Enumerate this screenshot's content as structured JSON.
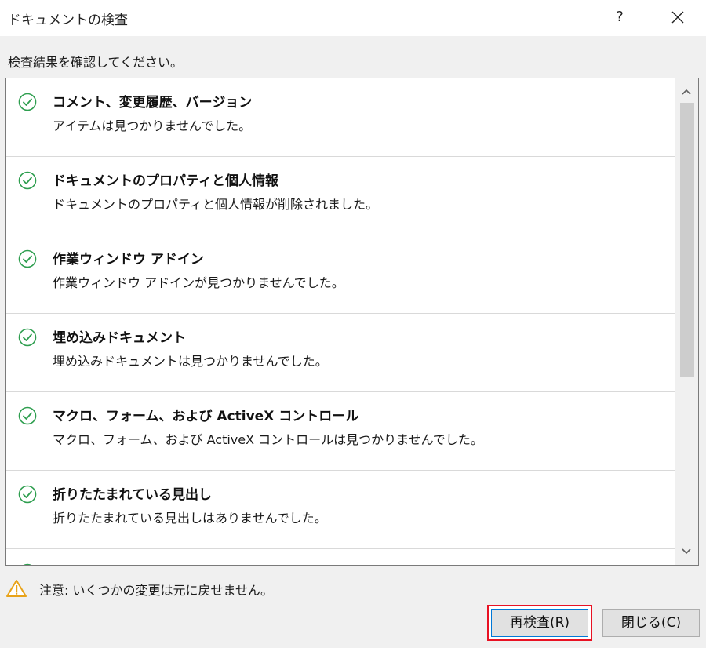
{
  "window": {
    "title": "ドキュメントの検査",
    "help_label": "?",
    "close_label": "✕"
  },
  "instruction": "検査結果を確認してください。",
  "results": [
    {
      "title": "コメント、変更履歴、バージョン",
      "desc": "アイテムは見つかりませんでした。"
    },
    {
      "title": "ドキュメントのプロパティと個人情報",
      "desc": "ドキュメントのプロパティと個人情報が削除されました。"
    },
    {
      "title": "作業ウィンドウ アドイン",
      "desc": "作業ウィンドウ アドインが見つかりませんでした。"
    },
    {
      "title": "埋め込みドキュメント",
      "desc": "埋め込みドキュメントは見つかりませんでした。"
    },
    {
      "title": "マクロ、フォーム、および ActiveX コントロール",
      "desc": "マクロ、フォーム、および ActiveX コントロールは見つかりませんでした。"
    },
    {
      "title": "折りたたまれている見出し",
      "desc": "折りたたまれている見出しはありませんでした。"
    }
  ],
  "scrollbar": {
    "up": "˄",
    "down": "˅"
  },
  "warning": "注意: いくつかの変更は元に戻せません。",
  "buttons": {
    "reinspect": "再検査(R)",
    "reinspect_prefix": "再検査(",
    "reinspect_key": "R",
    "reinspect_suffix": ")",
    "close": "閉じる(C)",
    "close_prefix": "閉じる(",
    "close_key": "C",
    "close_suffix": ")"
  },
  "colors": {
    "check": "#2e9e4f",
    "warning": "#e8a31a",
    "highlight": "#e81123"
  }
}
